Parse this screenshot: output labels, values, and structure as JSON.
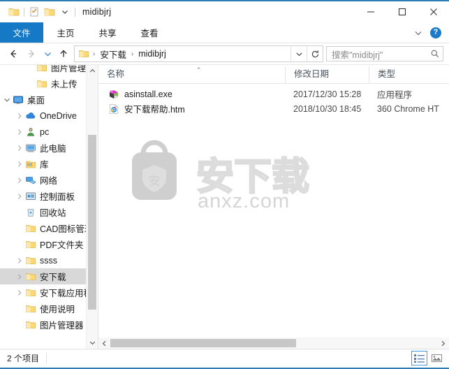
{
  "window": {
    "title": "midibjrj",
    "quick_access": [
      {
        "name": "folder-icon",
        "label": "文件夹"
      },
      {
        "name": "properties-icon",
        "label": "属性"
      },
      {
        "name": "new-folder-icon",
        "label": "新建文件夹"
      },
      {
        "name": "chevron-down-icon",
        "label": "自定义快速访问工具栏"
      }
    ],
    "controls": {
      "minimize": "最小化",
      "maximize": "最大化",
      "close": "关闭"
    }
  },
  "ribbon": {
    "tabs": [
      {
        "label": "文件",
        "active": true
      },
      {
        "label": "主页",
        "active": false
      },
      {
        "label": "共享",
        "active": false
      },
      {
        "label": "查看",
        "active": false
      }
    ],
    "collapse_label": "展开功能区",
    "help_label": "?"
  },
  "navbar": {
    "back": "后退",
    "forward": "前进",
    "recent": "最近浏览的位置",
    "up": "上移到",
    "breadcrumbs": [
      "安下载",
      "midibjrj"
    ],
    "crumb_separator": "›",
    "dropdown": "以前的位置",
    "refresh": "刷新",
    "search": {
      "placeholder": "搜索\"midibjrj\"",
      "icon": "search-icon"
    }
  },
  "sidebar": {
    "items": [
      {
        "label": "图片管理器",
        "icon": "folder-icon",
        "indent": 2,
        "twisty": "none",
        "selected": false
      },
      {
        "label": "未上传",
        "icon": "folder-icon",
        "indent": 2,
        "twisty": "none",
        "selected": false
      },
      {
        "label": "桌面",
        "icon": "desktop-icon",
        "indent": 0,
        "twisty": "expanded",
        "selected": false
      },
      {
        "label": "OneDrive",
        "icon": "cloud-icon",
        "indent": 1,
        "twisty": "collapsed",
        "selected": false
      },
      {
        "label": "pc",
        "icon": "user-icon",
        "indent": 1,
        "twisty": "collapsed",
        "selected": false
      },
      {
        "label": "此电脑",
        "icon": "this-pc-icon",
        "indent": 1,
        "twisty": "collapsed",
        "selected": false
      },
      {
        "label": "库",
        "icon": "library-icon",
        "indent": 1,
        "twisty": "collapsed",
        "selected": false
      },
      {
        "label": "网络",
        "icon": "network-icon",
        "indent": 1,
        "twisty": "collapsed",
        "selected": false
      },
      {
        "label": "控制面板",
        "icon": "control-panel-icon",
        "indent": 1,
        "twisty": "collapsed",
        "selected": false
      },
      {
        "label": "回收站",
        "icon": "recycle-bin-icon",
        "indent": 1,
        "twisty": "none",
        "selected": false
      },
      {
        "label": "CAD图标管理",
        "icon": "folder-icon",
        "indent": 1,
        "twisty": "none",
        "selected": false
      },
      {
        "label": "PDF文件夹",
        "icon": "folder-icon",
        "indent": 1,
        "twisty": "none",
        "selected": false
      },
      {
        "label": "ssss",
        "icon": "folder-icon",
        "indent": 1,
        "twisty": "collapsed",
        "selected": false
      },
      {
        "label": "安下载",
        "icon": "folder-icon",
        "indent": 1,
        "twisty": "collapsed",
        "selected": true
      },
      {
        "label": "安下载应用程序",
        "icon": "folder-icon",
        "indent": 1,
        "twisty": "collapsed",
        "selected": false
      },
      {
        "label": "使用说明",
        "icon": "folder-icon",
        "indent": 1,
        "twisty": "none",
        "selected": false
      },
      {
        "label": "图片管理器",
        "icon": "folder-icon",
        "indent": 1,
        "twisty": "none",
        "selected": false
      }
    ]
  },
  "filelist": {
    "columns": [
      {
        "label": "名称",
        "sorted": "asc"
      },
      {
        "label": "修改日期",
        "sorted": ""
      },
      {
        "label": "类型",
        "sorted": ""
      }
    ],
    "sort_caret": "⌃",
    "rows": [
      {
        "name": "asinstall.exe",
        "date": "2017/12/30 15:28",
        "type": "应用程序",
        "icon": "exe-app-icon"
      },
      {
        "name": "安下载帮助.htm",
        "date": "2018/10/30 18:45",
        "type": "360 Chrome HT",
        "icon": "chrome-html-icon"
      }
    ]
  },
  "watermark": {
    "brand_cn": "安下载",
    "brand_url": "anxz.com",
    "badge_char": "安"
  },
  "statusbar": {
    "item_count": "2 个项目",
    "views": [
      {
        "name": "details-view",
        "label": "详细信息",
        "active": true
      },
      {
        "name": "large-icons-view",
        "label": "大图标",
        "active": false
      }
    ]
  },
  "colors": {
    "accent": "#1579c6",
    "window_border": "#2b7cb5",
    "selection": "#d8d8d8",
    "folder_yellow": "#fbd978",
    "scroll_thumb": "#c7c7c7"
  }
}
